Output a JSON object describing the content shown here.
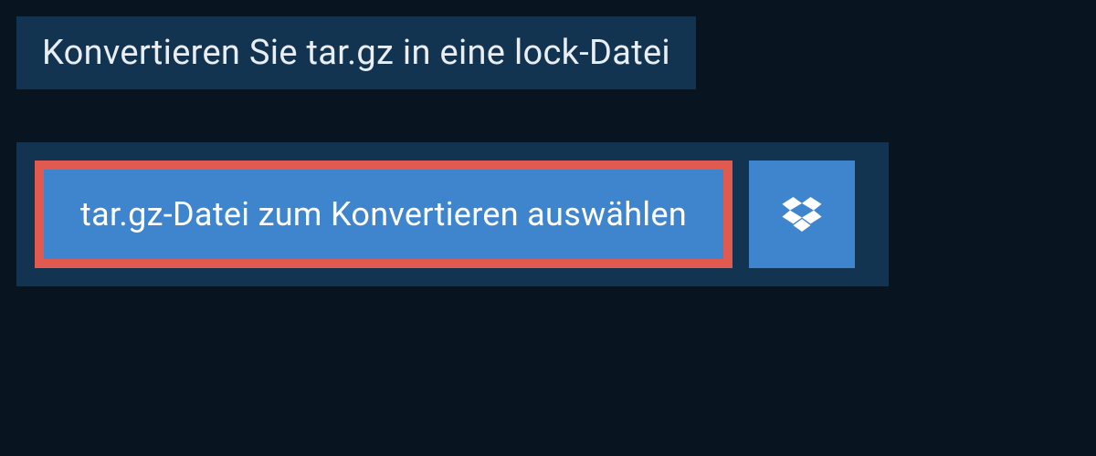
{
  "header": {
    "title": "Konvertieren Sie tar.gz in eine lock-Datei"
  },
  "actions": {
    "select_file_label": "tar.gz-Datei zum Konvertieren auswählen",
    "dropbox_icon_name": "dropbox-icon"
  },
  "colors": {
    "background": "#081420",
    "panel": "#133451",
    "button": "#3f85ce",
    "highlight_border": "#e15a4f",
    "text_light": "#e8eef4",
    "text_white": "#ffffff"
  }
}
